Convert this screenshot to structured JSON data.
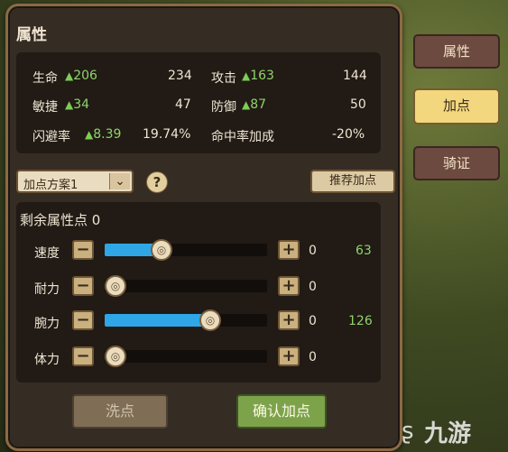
{
  "panel": {
    "title": "属性"
  },
  "stats": {
    "rows": [
      [
        {
          "label": "生命",
          "bonus": "206",
          "value": "234"
        },
        {
          "label": "攻击",
          "bonus": "163",
          "value": "144"
        }
      ],
      [
        {
          "label": "敏捷",
          "bonus": "34",
          "value": "47"
        },
        {
          "label": "防御",
          "bonus": "87",
          "value": "50"
        }
      ],
      [
        {
          "label": "闪避率",
          "bonus": "8.39",
          "value": "19.74%"
        },
        {
          "label": "命中率加成",
          "bonus": "",
          "value": "-20%"
        }
      ]
    ]
  },
  "plan": {
    "selected": "加点方案1",
    "help": "?",
    "recommend": "推荐加点"
  },
  "allocation": {
    "remaining_label": "剩余属性点",
    "remaining_value": "0",
    "rows": [
      {
        "label": "速度",
        "added": "0",
        "value": "63",
        "fill": 0.35
      },
      {
        "label": "耐力",
        "added": "0",
        "value": "",
        "fill": 0.0
      },
      {
        "label": "腕力",
        "added": "0",
        "value": "126",
        "fill": 0.65
      },
      {
        "label": "体力",
        "added": "0",
        "value": "",
        "fill": 0.0
      }
    ]
  },
  "buttons": {
    "wash": "洗点",
    "confirm": "确认加点"
  },
  "tabs": [
    "属性",
    "加点",
    "骑证"
  ],
  "watermark": "九游",
  "colors": {
    "accent": "#2fa7e6",
    "bonus": "#8fd36a",
    "active_tab": "#f2d77f"
  }
}
